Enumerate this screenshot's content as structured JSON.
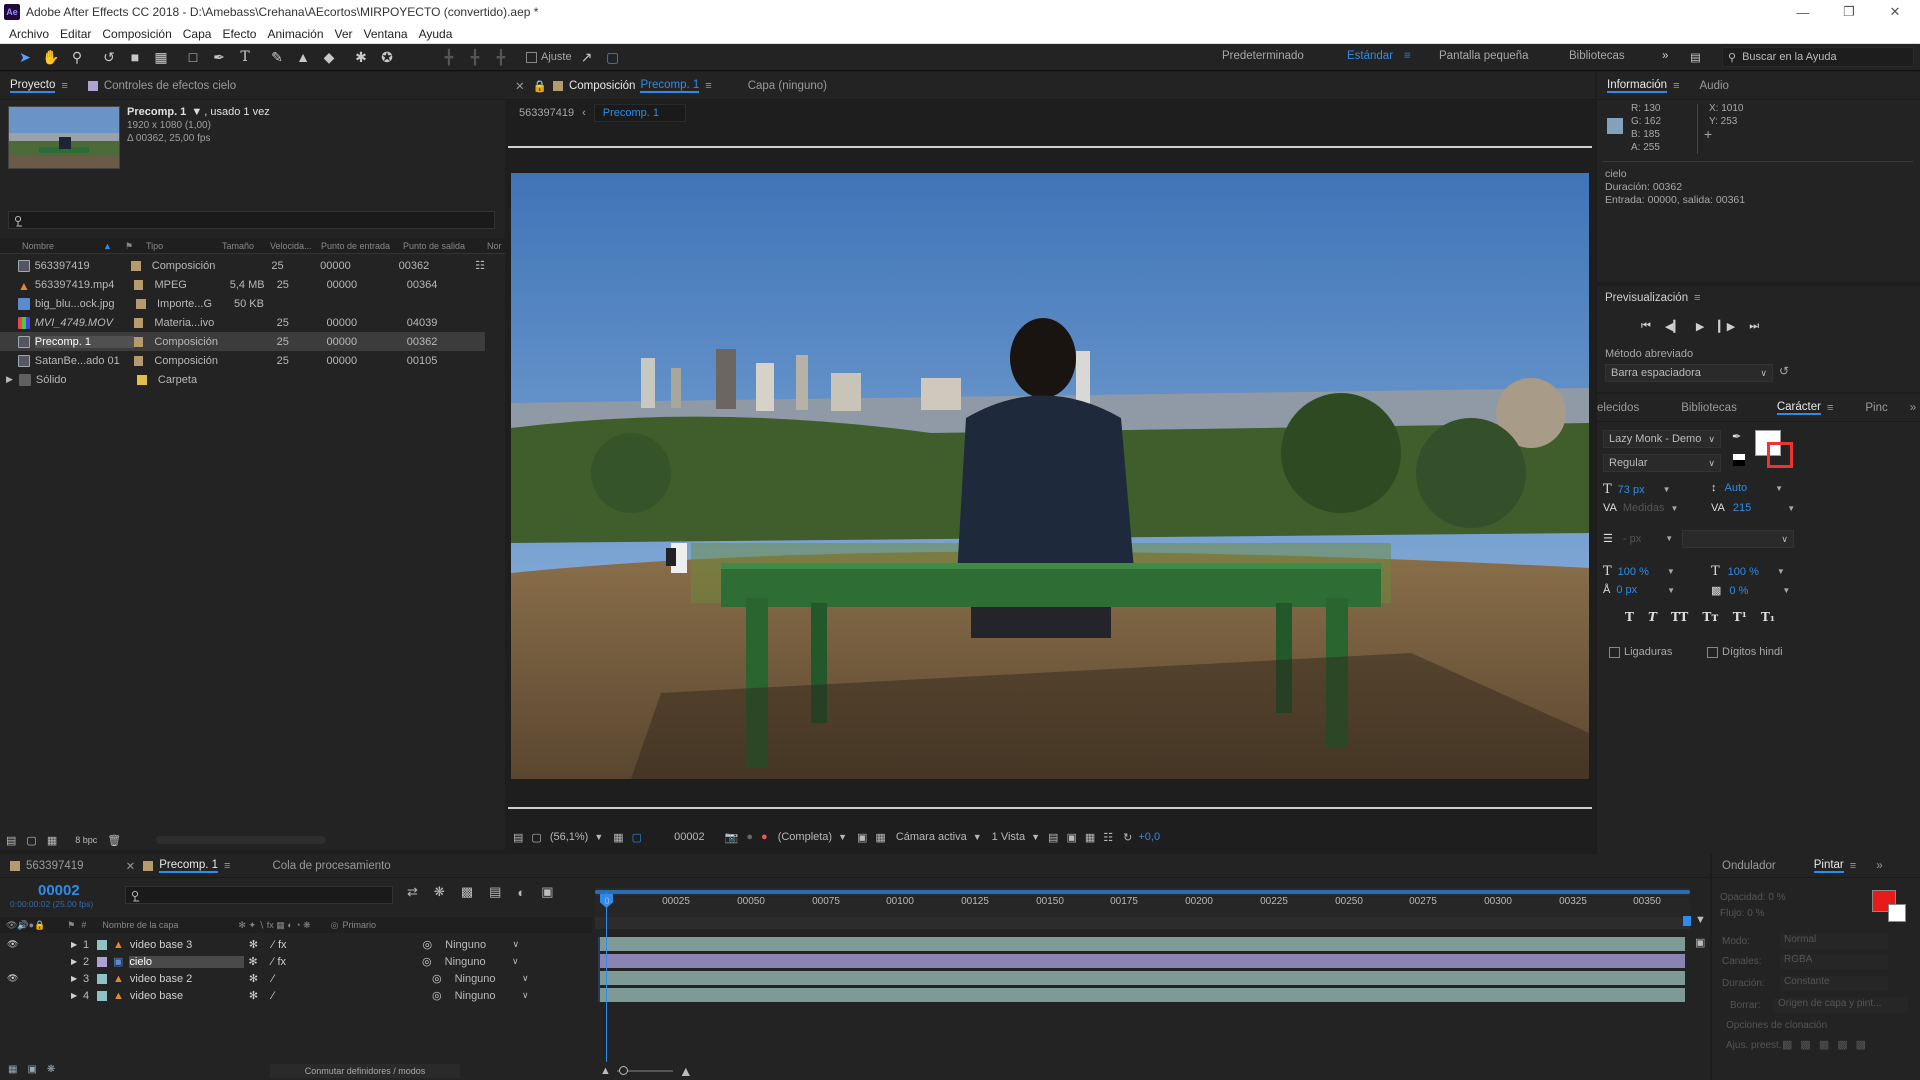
{
  "app": {
    "title": "Adobe After Effects CC 2018 - D:\\Amebass\\Crehana\\AEcortos\\MIRPOYECTO (convertido).aep *",
    "logo": "Ae"
  },
  "menu": [
    "Archivo",
    "Editar",
    "Composición",
    "Capa",
    "Efecto",
    "Animación",
    "Ver",
    "Ventana",
    "Ayuda"
  ],
  "toolbar": {
    "tools": [
      "selection-tool",
      "hand-tool",
      "zoom-tool",
      "rotate-tool",
      "camera-tool",
      "pan-behind-tool",
      "rectangle-tool",
      "pen-tool",
      "type-tool",
      "brush-tool",
      "clone-stamp-tool",
      "eraser-tool",
      "roto-brush-tool",
      "puppet-pin-tool"
    ],
    "ajuste_label": "Ajuste",
    "workspaces": [
      "Predeterminado",
      "Estándar",
      "Pantalla pequeña",
      "Bibliotecas"
    ],
    "active_workspace": "Estándar",
    "search_placeholder": "Buscar en la Ayuda"
  },
  "project_panel": {
    "tab_project": "Proyecto",
    "tab_effects": "Controles de efectos cielo",
    "preview_name": "Precomp. 1",
    "preview_used": ", usado 1 vez",
    "preview_res": "1920 x 1080 (1,00)",
    "preview_dur": "Δ 00362, 25,00 fps",
    "search_placeholder": "",
    "columns": [
      "Nombre",
      "Tipo",
      "Tamaño",
      "Velocida...",
      "Punto de entrada",
      "Punto de salida",
      "Nor"
    ],
    "items": [
      {
        "name": "563397419",
        "type": "Composición",
        "size": "",
        "fps": "25",
        "in": "00000",
        "out": "00362",
        "color": "#b59a6d",
        "icon": "comp"
      },
      {
        "name": "563397419.mp4",
        "type": "MPEG",
        "size": "5,4 MB",
        "fps": "25",
        "in": "00000",
        "out": "00364",
        "color": "#b59a6d",
        "icon": "video"
      },
      {
        "name": "big_blu...ock.jpg",
        "type": "Importe...G",
        "size": "50 KB",
        "fps": "",
        "in": "",
        "out": "",
        "color": "#b59a6d",
        "icon": "image"
      },
      {
        "name": "MVI_4749.MOV",
        "type": "Materia...ivo",
        "size": "",
        "fps": "25",
        "in": "00000",
        "out": "04039",
        "color": "#b59a6d",
        "icon": "footage"
      },
      {
        "name": "Precomp. 1",
        "type": "Composición",
        "size": "",
        "fps": "25",
        "in": "00000",
        "out": "00362",
        "color": "#b59a6d",
        "icon": "comp"
      },
      {
        "name": "SatanBe...ado 01",
        "type": "Composición",
        "size": "",
        "fps": "25",
        "in": "00000",
        "out": "00105",
        "color": "#b59a6d",
        "icon": "comp"
      },
      {
        "name": "Sólido",
        "type": "Carpeta",
        "size": "",
        "fps": "",
        "in": "",
        "out": "",
        "color": "#e0c04a",
        "icon": "folder"
      }
    ],
    "bpc": "8 bpc"
  },
  "comp_panel": {
    "tab_label": "Composición",
    "tab_name": "Precomp. 1",
    "layer_tab": "Capa (ninguno)",
    "breadcrumb": [
      "563397419",
      "Precomp. 1"
    ],
    "zoom": "(56,1%)",
    "timecode": "00002",
    "resolution": "(Completa)",
    "camera": "Cámara activa",
    "views": "1 Vista",
    "exposure": "+0,0"
  },
  "info_panel": {
    "tab_info": "Información",
    "tab_audio": "Audio",
    "r": "R:  130",
    "g": "G:  162",
    "b": "B:  185",
    "a": "A:  255",
    "x": "X:  1010",
    "y": "Y:  253",
    "sample_color": "#82a2b9",
    "layer_name": "cielo",
    "duration": "Duración: 00362",
    "inout": "Entrada: 00000, salida: 00361"
  },
  "preview_panel": {
    "title": "Previsualización",
    "shortcut_label": "Método abreviado",
    "shortcut_value": "Barra espaciadora"
  },
  "character_panel": {
    "tabs": [
      "elecidos",
      "Bibliotecas",
      "Carácter",
      "Pinc"
    ],
    "active_tab": "Carácter",
    "font": "Lazy Monk - Demo",
    "style": "Regular",
    "size": "73 px",
    "leading": "Auto",
    "kerning": "Medidas",
    "tracking": "215",
    "stroke": "- px",
    "vscale": "100 %",
    "hscale": "100 %",
    "baseline": "0 px",
    "tsume": "0 %",
    "type_buttons": [
      "T",
      "T",
      "TT",
      "Tт",
      "T¹",
      "T₁"
    ],
    "ligaduras": "Ligaduras",
    "digitos": "Dígitos hindi"
  },
  "timeline": {
    "tabs": [
      "563397419",
      "Precomp. 1",
      "Cola de procesamiento"
    ],
    "active_tab": "Precomp. 1",
    "timecode": "00002",
    "timecode_sub": "0:00:00:02 (25.00 fps)",
    "col_layer": "Nombre de la capa",
    "col_parent": "Primario",
    "ruler": [
      "00025",
      "00050",
      "00075",
      "00100",
      "00125",
      "00150",
      "00175",
      "00200",
      "00225",
      "00250",
      "00275",
      "00300",
      "00325",
      "00350"
    ],
    "layers": [
      {
        "num": "1",
        "name": "video base 3",
        "parent": "Ninguno",
        "color": "#8fc3c3",
        "selected": false,
        "eye": true
      },
      {
        "num": "2",
        "name": "cielo",
        "parent": "Ninguno",
        "color": "#b0a3d4",
        "selected": true,
        "eye": false
      },
      {
        "num": "3",
        "name": "video base 2",
        "parent": "Ninguno",
        "color": "#8fc3c3",
        "selected": false,
        "eye": true
      },
      {
        "num": "4",
        "name": "video base",
        "parent": "Ninguno",
        "color": "#8fc3c3",
        "selected": false,
        "eye": false
      }
    ],
    "footer_toggle": "Conmutar definidores / modos"
  },
  "paint_panel": {
    "tab_wiggler": "Ondulador",
    "tab_paint": "Pintar",
    "opacity": "Opacidad: 0 %",
    "flow": "Flujo: 0 %",
    "mode_label": "Modo:",
    "mode_value": "Normal",
    "channels_label": "Canales:",
    "channels_value": "RGBA",
    "duration_label": "Duración:",
    "duration_value": "Constante",
    "erase_label": "Borrar:",
    "erase_value": "Origen de capa y pint...",
    "clone_label": "Opciones de clonación",
    "preset_label": "Ajus. preest.",
    "fg_color": "#e81a1a",
    "bg_color": "#ffffff"
  }
}
